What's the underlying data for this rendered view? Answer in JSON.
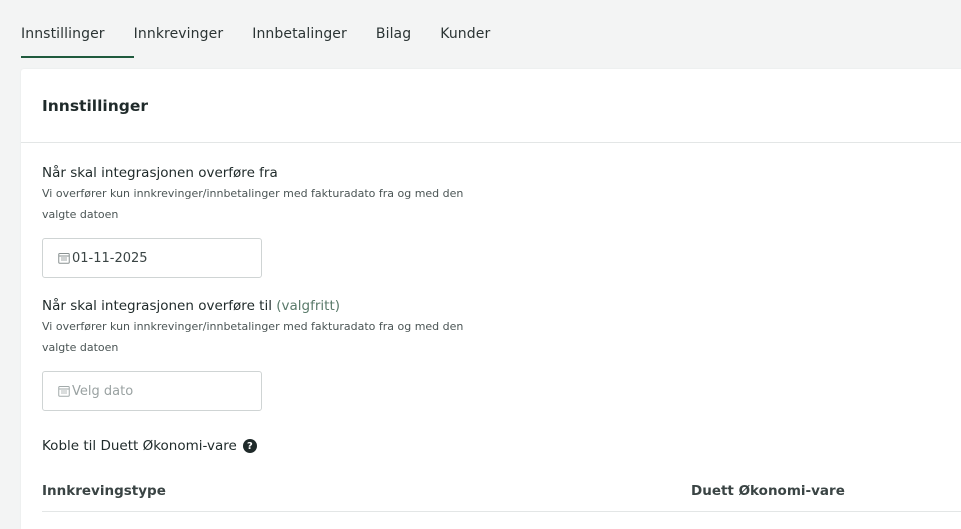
{
  "tabs": [
    {
      "label": "Innstillinger",
      "active": true
    },
    {
      "label": "Innkrevinger",
      "active": false
    },
    {
      "label": "Innbetalinger",
      "active": false
    },
    {
      "label": "Bilag",
      "active": false
    },
    {
      "label": "Kunder",
      "active": false
    }
  ],
  "card": {
    "title": "Innstillinger"
  },
  "from_field": {
    "label": "Når skal integrasjonen overføre fra",
    "help": "Vi overfører kun innkrevinger/innbetalinger med fakturadato fra og med den valgte datoen",
    "value": "01-11-2025",
    "icon": "calendar-icon"
  },
  "to_field": {
    "label": "Når skal integrasjonen overføre til",
    "optional": "(valgfritt)",
    "help": "Vi overfører kun innkrevinger/innbetalinger med fakturadato fra og med den valgte datoen",
    "placeholder": "Velg dato",
    "icon": "calendar-icon"
  },
  "link_section": {
    "label": "Koble til Duett Økonomi-vare",
    "icon": "question-icon"
  },
  "table": {
    "headers": [
      "Innkrevingstype",
      "Duett Økonomi-vare"
    ]
  },
  "colors": {
    "accent": "#1f5a3d",
    "background": "#f3f4f4",
    "card": "#ffffff"
  }
}
